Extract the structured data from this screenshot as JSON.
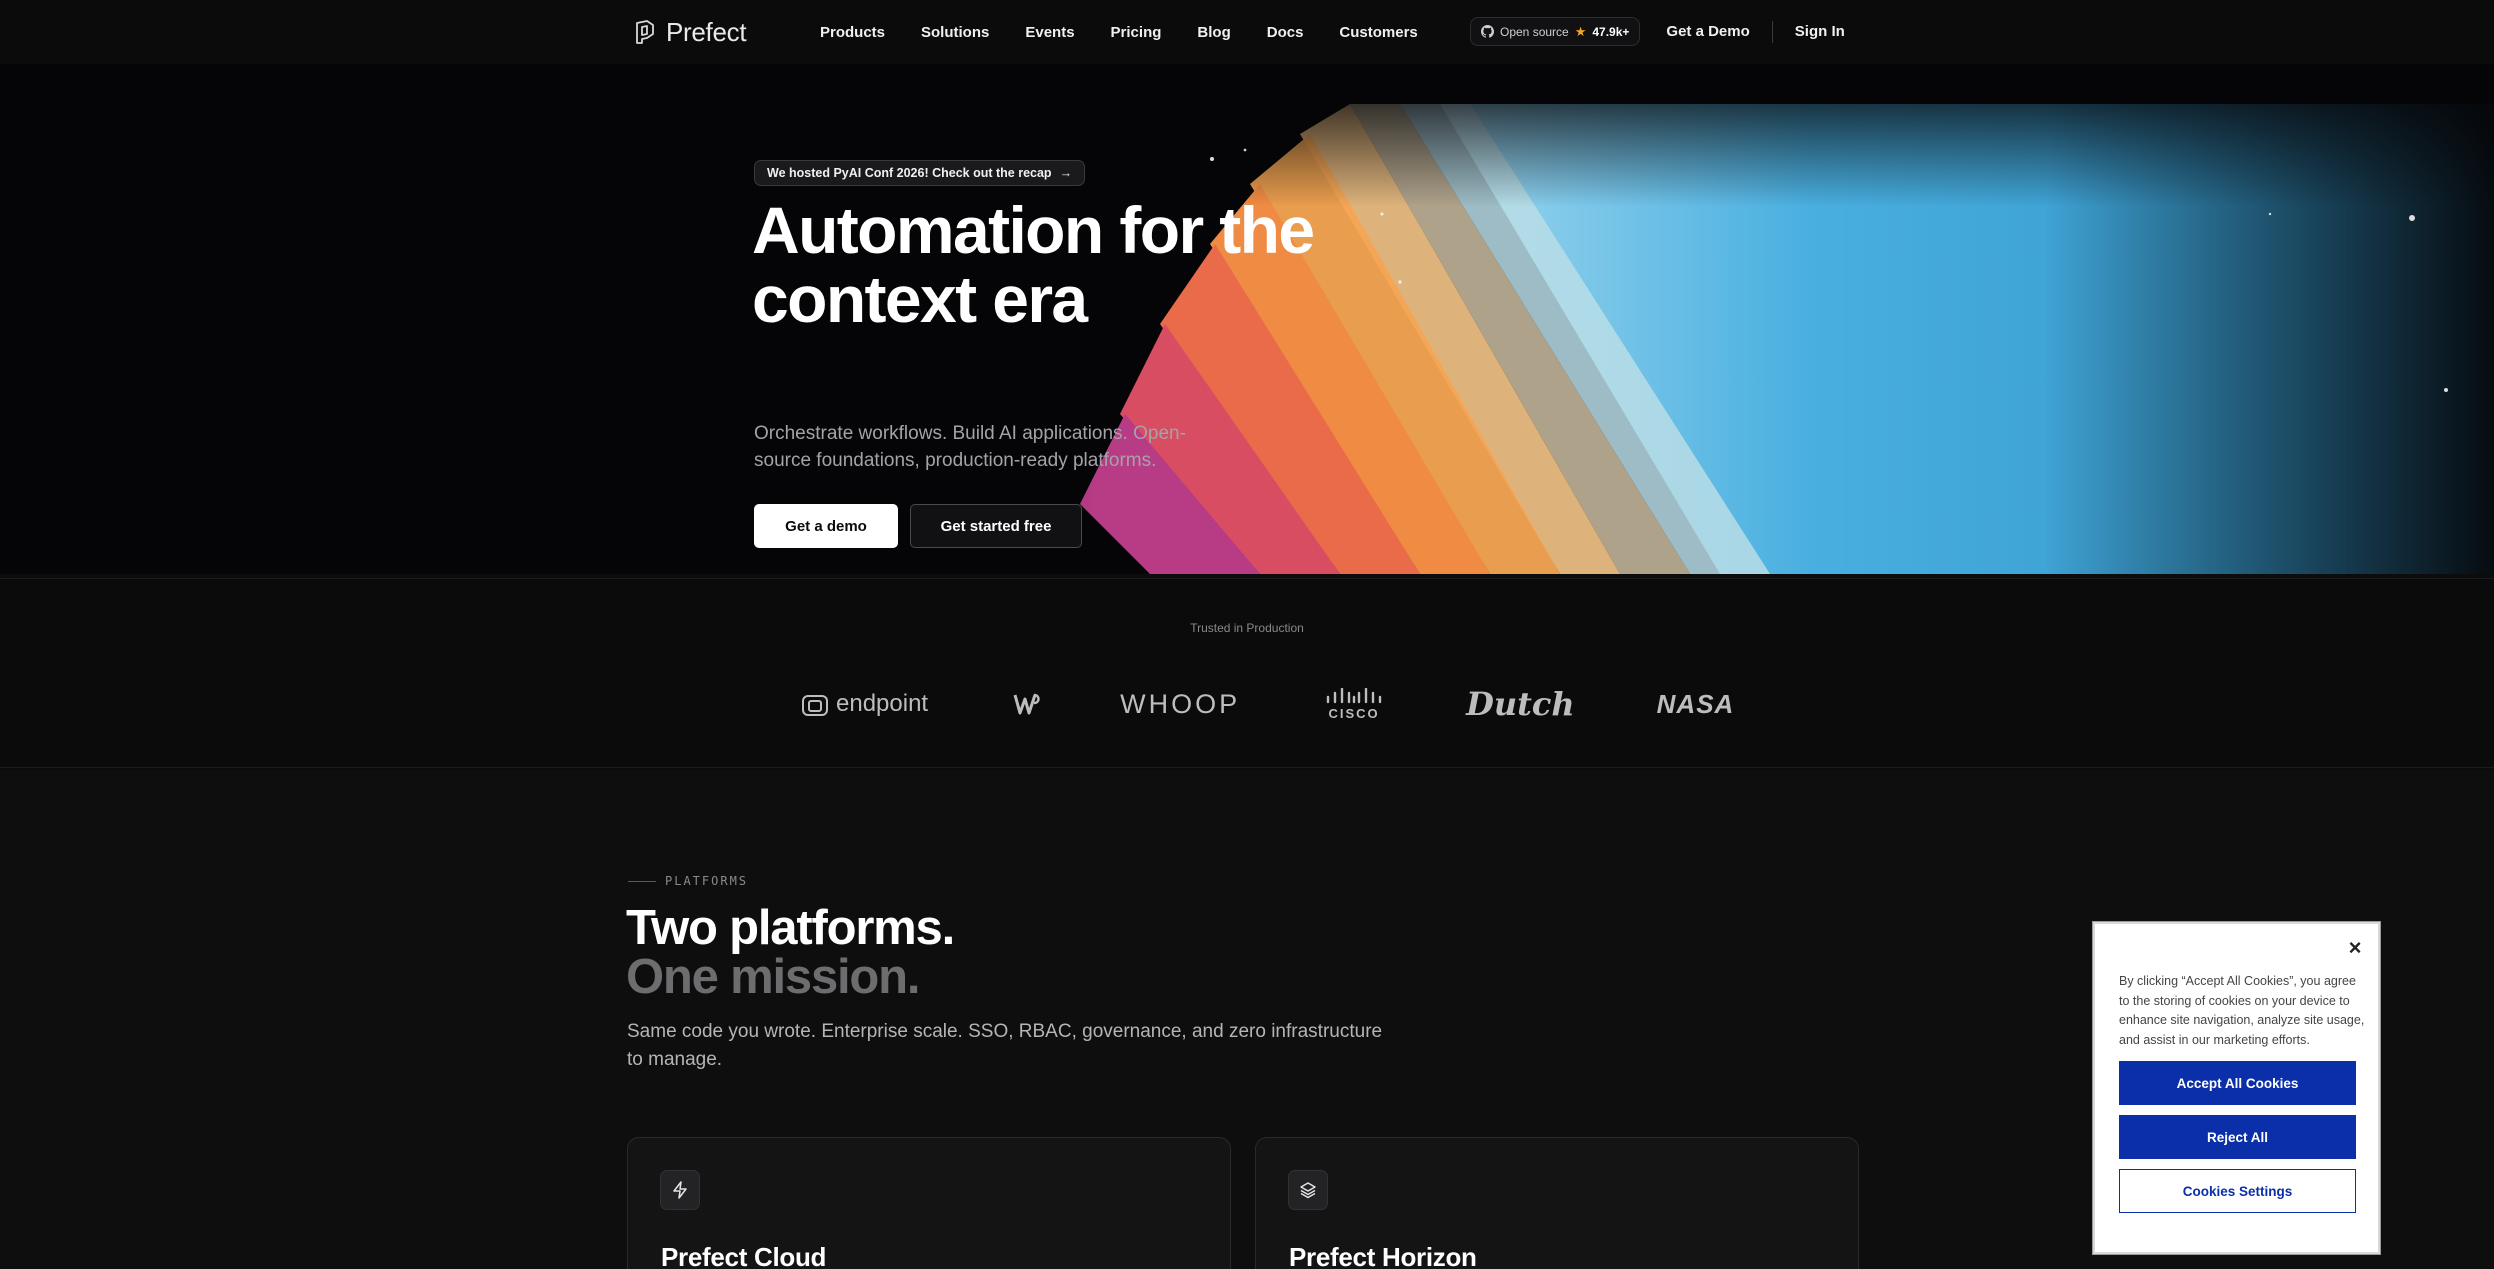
{
  "nav": {
    "brand": "Prefect",
    "links": [
      "Products",
      "Solutions",
      "Events",
      "Pricing",
      "Blog",
      "Docs",
      "Customers"
    ],
    "github": {
      "label": "Open source",
      "stars": "47.9k+"
    },
    "demo_label": "Get a Demo",
    "signin_label": "Sign In"
  },
  "hero": {
    "announcement": "We hosted PyAI Conf 2026! Check out the recap",
    "title": "Automation for the context era",
    "subtitle": "Orchestrate workflows. Build AI applications. Open-source foundations, production-ready platforms.",
    "primary_cta": "Get a demo",
    "secondary_cta": "Get started free"
  },
  "trusted": {
    "label": "Trusted in Production",
    "logos": [
      "endpoint",
      "Washington Nationals",
      "WHOOP",
      "cisco",
      "Dutch",
      "NASA"
    ],
    "endpoint_text": "endpoint",
    "whoop_text": "WHOOP",
    "cisco_text": "CISCO",
    "dutch_text": "Dutch",
    "nasa_text": "NASA"
  },
  "platforms": {
    "eyebrow": "PLATFORMS",
    "title_line1": "Two platforms.",
    "title_line2": "One mission.",
    "subtitle": "Same code you wrote. Enterprise scale. SSO, RBAC, governance, and zero infrastructure to manage.",
    "cards": [
      {
        "title": "Prefect Cloud",
        "icon": "lightning-icon"
      },
      {
        "title": "Prefect Horizon",
        "icon": "layers-icon"
      }
    ]
  },
  "cookie": {
    "text": "By clicking “Accept All Cookies”, you agree to the storing of cookies on your device to enhance site navigation, analyze site usage, and assist in our marketing efforts.",
    "accept": "Accept All Cookies",
    "reject": "Reject All",
    "settings": "Cookies Settings",
    "close": "×"
  },
  "colors": {
    "background": "#0c0c0d",
    "cookie_primary": "#0a2fa8",
    "hero_blue": "#3fa4d6",
    "hero_orange": "#f6a552",
    "hero_pink": "#c13d84"
  }
}
